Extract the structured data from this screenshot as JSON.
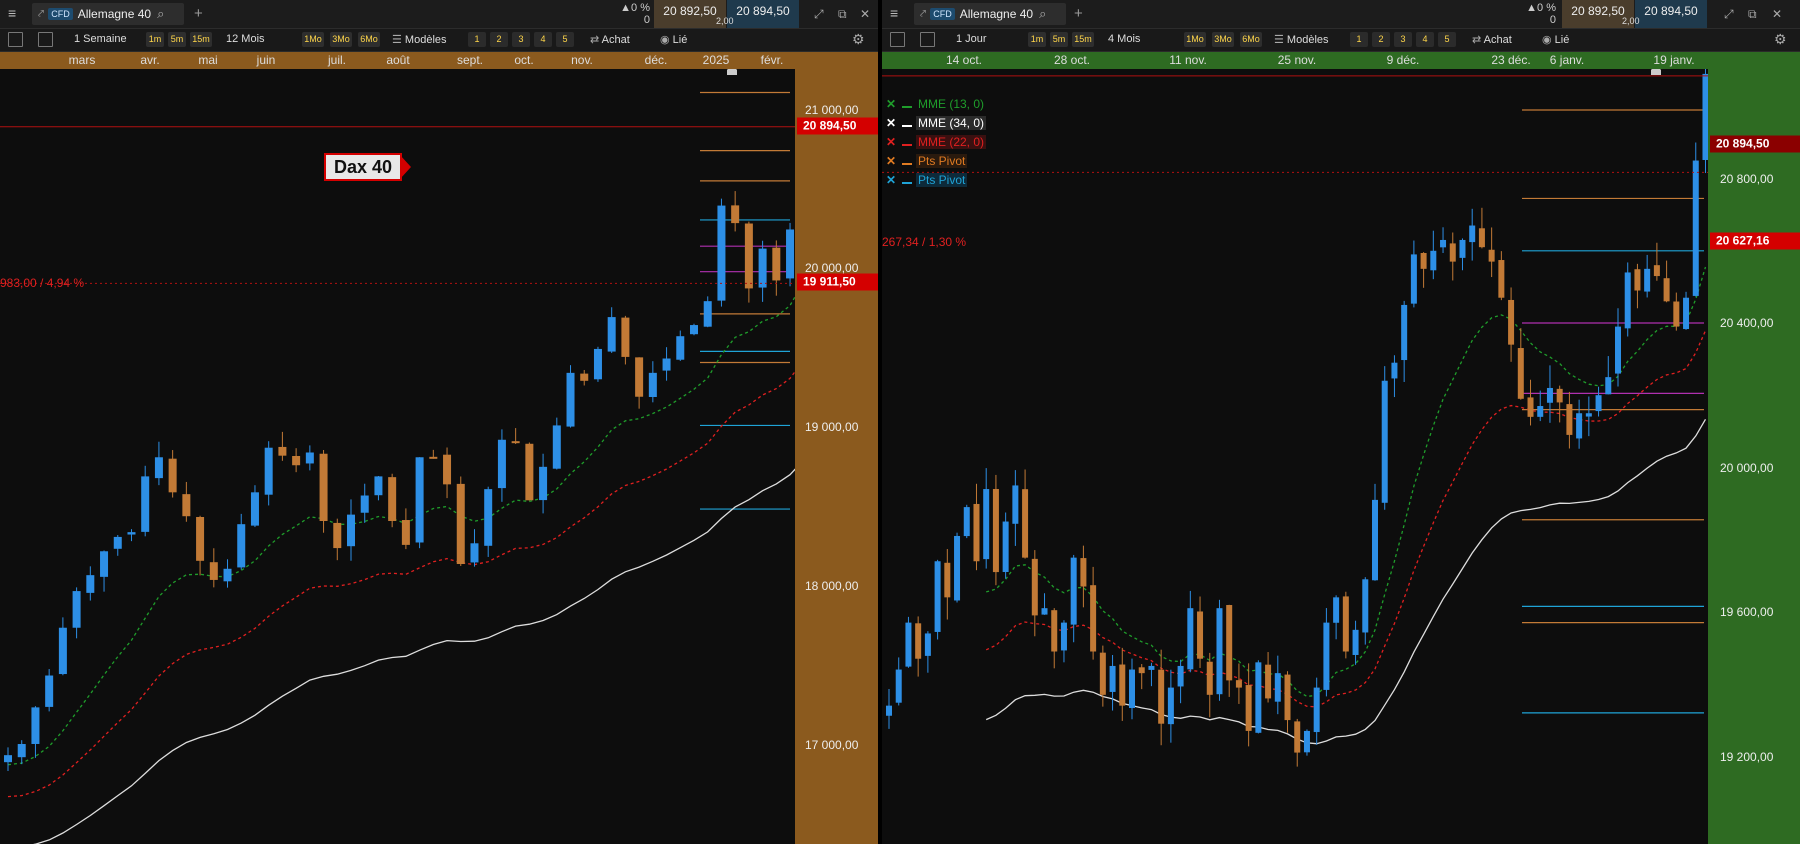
{
  "left": {
    "instrument": "Allemagne 40",
    "cfd_badge": "CFD",
    "change": "▲0 %",
    "change_count": "0",
    "bid": "20 892,50",
    "ask": "20 894,50",
    "spread": "2,00",
    "toolbar": {
      "period": "1 Semaine",
      "tf1": "1m",
      "tf2": "5m",
      "tf3": "15m",
      "range": "12 Mois",
      "r1": "1Mo",
      "r2": "3Mo",
      "r3": "6Mo",
      "models": "Modèles",
      "n1": "1",
      "n2": "2",
      "n3": "3",
      "n4": "4",
      "n5": "5",
      "buy": "Achat",
      "link": "Lié"
    },
    "x_labels": [
      "mars",
      "avr.",
      "mai",
      "juin",
      "juil.",
      "août",
      "sept.",
      "oct.",
      "nov.",
      "déc.",
      "2025",
      "févr."
    ],
    "y_ticks": [
      "21 000,00",
      "20 000,00",
      "19 000,00",
      "18 000,00",
      "17 000,00"
    ],
    "price_current": "20 894,50",
    "price_ref": "19 911,50",
    "change_text": "983,00 / 4,94 %",
    "annotation": "Dax 40",
    "colors": {
      "up": "#2d8fe6",
      "down": "#c27a36",
      "axis_bg": "#8b5a1e"
    }
  },
  "right": {
    "instrument": "Allemagne 40",
    "cfd_badge": "CFD",
    "change": "▲0 %",
    "change_count": "0",
    "bid": "20 892,50",
    "ask": "20 894,50",
    "spread": "2,00",
    "toolbar": {
      "period": "1 Jour",
      "tf1": "1m",
      "tf2": "5m",
      "tf3": "15m",
      "range": "4 Mois",
      "r1": "1Mo",
      "r2": "3Mo",
      "r3": "6Mo",
      "models": "Modèles",
      "n1": "1",
      "n2": "2",
      "n3": "3",
      "n4": "4",
      "n5": "5",
      "buy": "Achat",
      "link": "Lié"
    },
    "x_labels": [
      "14 oct.",
      "28 oct.",
      "11 nov.",
      "25 nov.",
      "9 déc.",
      "23 déc.",
      "6 janv.",
      "19 janv."
    ],
    "y_ticks": [
      "20 800,00",
      "20 400,00",
      "20 000,00",
      "19 600,00",
      "19 200,00"
    ],
    "price_current": "20 894,50",
    "price_ref": "20 627,16",
    "change_text": "267,34 / 1,30 %",
    "legend": [
      {
        "label": "MME (13, 0)",
        "color": "#1f9d2b"
      },
      {
        "label": "MME (34, 0)",
        "color": "#ffffff"
      },
      {
        "label": "MME (22, 0)",
        "color": "#e02020"
      },
      {
        "label": "Pts Pivot",
        "color": "#e07b22"
      },
      {
        "label": "Pts Pivot",
        "color": "#1fa3d6"
      }
    ],
    "colors": {
      "up": "#2d8fe6",
      "down": "#c27a36",
      "axis_bg": "#2e6b22"
    }
  }
}
